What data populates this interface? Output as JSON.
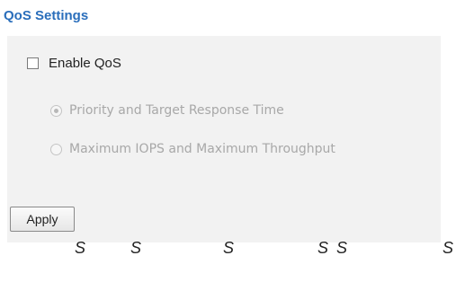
{
  "section": {
    "title": "QoS Settings"
  },
  "enable": {
    "label": "Enable QoS",
    "checked": false
  },
  "radios": [
    {
      "label": "Priority and Target Response Time",
      "selected": true,
      "disabled": true
    },
    {
      "label": "Maximum IOPS and Maximum Throughput",
      "selected": false,
      "disabled": true
    }
  ],
  "apply_button": {
    "label": "Apply"
  },
  "footer_chars": [
    "S",
    "S",
    "S",
    "S",
    "S",
    "S"
  ],
  "colors": {
    "title": "#2a6ebb",
    "panel_background": "#f2f2f2",
    "disabled_text": "#a8a8a8"
  }
}
